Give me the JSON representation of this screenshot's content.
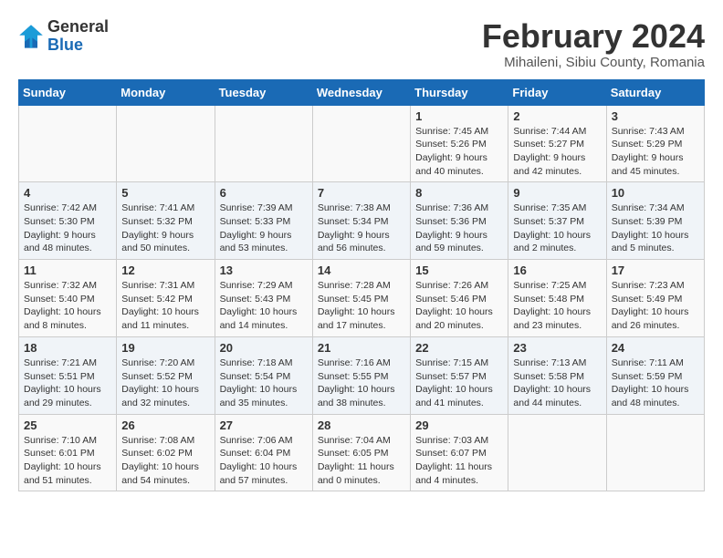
{
  "logo": {
    "text_general": "General",
    "text_blue": "Blue"
  },
  "header": {
    "month": "February 2024",
    "location": "Mihaileni, Sibiu County, Romania"
  },
  "weekdays": [
    "Sunday",
    "Monday",
    "Tuesday",
    "Wednesday",
    "Thursday",
    "Friday",
    "Saturday"
  ],
  "weeks": [
    [
      {
        "day": "",
        "info": ""
      },
      {
        "day": "",
        "info": ""
      },
      {
        "day": "",
        "info": ""
      },
      {
        "day": "",
        "info": ""
      },
      {
        "day": "1",
        "info": "Sunrise: 7:45 AM\nSunset: 5:26 PM\nDaylight: 9 hours and 40 minutes."
      },
      {
        "day": "2",
        "info": "Sunrise: 7:44 AM\nSunset: 5:27 PM\nDaylight: 9 hours and 42 minutes."
      },
      {
        "day": "3",
        "info": "Sunrise: 7:43 AM\nSunset: 5:29 PM\nDaylight: 9 hours and 45 minutes."
      }
    ],
    [
      {
        "day": "4",
        "info": "Sunrise: 7:42 AM\nSunset: 5:30 PM\nDaylight: 9 hours and 48 minutes."
      },
      {
        "day": "5",
        "info": "Sunrise: 7:41 AM\nSunset: 5:32 PM\nDaylight: 9 hours and 50 minutes."
      },
      {
        "day": "6",
        "info": "Sunrise: 7:39 AM\nSunset: 5:33 PM\nDaylight: 9 hours and 53 minutes."
      },
      {
        "day": "7",
        "info": "Sunrise: 7:38 AM\nSunset: 5:34 PM\nDaylight: 9 hours and 56 minutes."
      },
      {
        "day": "8",
        "info": "Sunrise: 7:36 AM\nSunset: 5:36 PM\nDaylight: 9 hours and 59 minutes."
      },
      {
        "day": "9",
        "info": "Sunrise: 7:35 AM\nSunset: 5:37 PM\nDaylight: 10 hours and 2 minutes."
      },
      {
        "day": "10",
        "info": "Sunrise: 7:34 AM\nSunset: 5:39 PM\nDaylight: 10 hours and 5 minutes."
      }
    ],
    [
      {
        "day": "11",
        "info": "Sunrise: 7:32 AM\nSunset: 5:40 PM\nDaylight: 10 hours and 8 minutes."
      },
      {
        "day": "12",
        "info": "Sunrise: 7:31 AM\nSunset: 5:42 PM\nDaylight: 10 hours and 11 minutes."
      },
      {
        "day": "13",
        "info": "Sunrise: 7:29 AM\nSunset: 5:43 PM\nDaylight: 10 hours and 14 minutes."
      },
      {
        "day": "14",
        "info": "Sunrise: 7:28 AM\nSunset: 5:45 PM\nDaylight: 10 hours and 17 minutes."
      },
      {
        "day": "15",
        "info": "Sunrise: 7:26 AM\nSunset: 5:46 PM\nDaylight: 10 hours and 20 minutes."
      },
      {
        "day": "16",
        "info": "Sunrise: 7:25 AM\nSunset: 5:48 PM\nDaylight: 10 hours and 23 minutes."
      },
      {
        "day": "17",
        "info": "Sunrise: 7:23 AM\nSunset: 5:49 PM\nDaylight: 10 hours and 26 minutes."
      }
    ],
    [
      {
        "day": "18",
        "info": "Sunrise: 7:21 AM\nSunset: 5:51 PM\nDaylight: 10 hours and 29 minutes."
      },
      {
        "day": "19",
        "info": "Sunrise: 7:20 AM\nSunset: 5:52 PM\nDaylight: 10 hours and 32 minutes."
      },
      {
        "day": "20",
        "info": "Sunrise: 7:18 AM\nSunset: 5:54 PM\nDaylight: 10 hours and 35 minutes."
      },
      {
        "day": "21",
        "info": "Sunrise: 7:16 AM\nSunset: 5:55 PM\nDaylight: 10 hours and 38 minutes."
      },
      {
        "day": "22",
        "info": "Sunrise: 7:15 AM\nSunset: 5:57 PM\nDaylight: 10 hours and 41 minutes."
      },
      {
        "day": "23",
        "info": "Sunrise: 7:13 AM\nSunset: 5:58 PM\nDaylight: 10 hours and 44 minutes."
      },
      {
        "day": "24",
        "info": "Sunrise: 7:11 AM\nSunset: 5:59 PM\nDaylight: 10 hours and 48 minutes."
      }
    ],
    [
      {
        "day": "25",
        "info": "Sunrise: 7:10 AM\nSunset: 6:01 PM\nDaylight: 10 hours and 51 minutes."
      },
      {
        "day": "26",
        "info": "Sunrise: 7:08 AM\nSunset: 6:02 PM\nDaylight: 10 hours and 54 minutes."
      },
      {
        "day": "27",
        "info": "Sunrise: 7:06 AM\nSunset: 6:04 PM\nDaylight: 10 hours and 57 minutes."
      },
      {
        "day": "28",
        "info": "Sunrise: 7:04 AM\nSunset: 6:05 PM\nDaylight: 11 hours and 0 minutes."
      },
      {
        "day": "29",
        "info": "Sunrise: 7:03 AM\nSunset: 6:07 PM\nDaylight: 11 hours and 4 minutes."
      },
      {
        "day": "",
        "info": ""
      },
      {
        "day": "",
        "info": ""
      }
    ]
  ]
}
